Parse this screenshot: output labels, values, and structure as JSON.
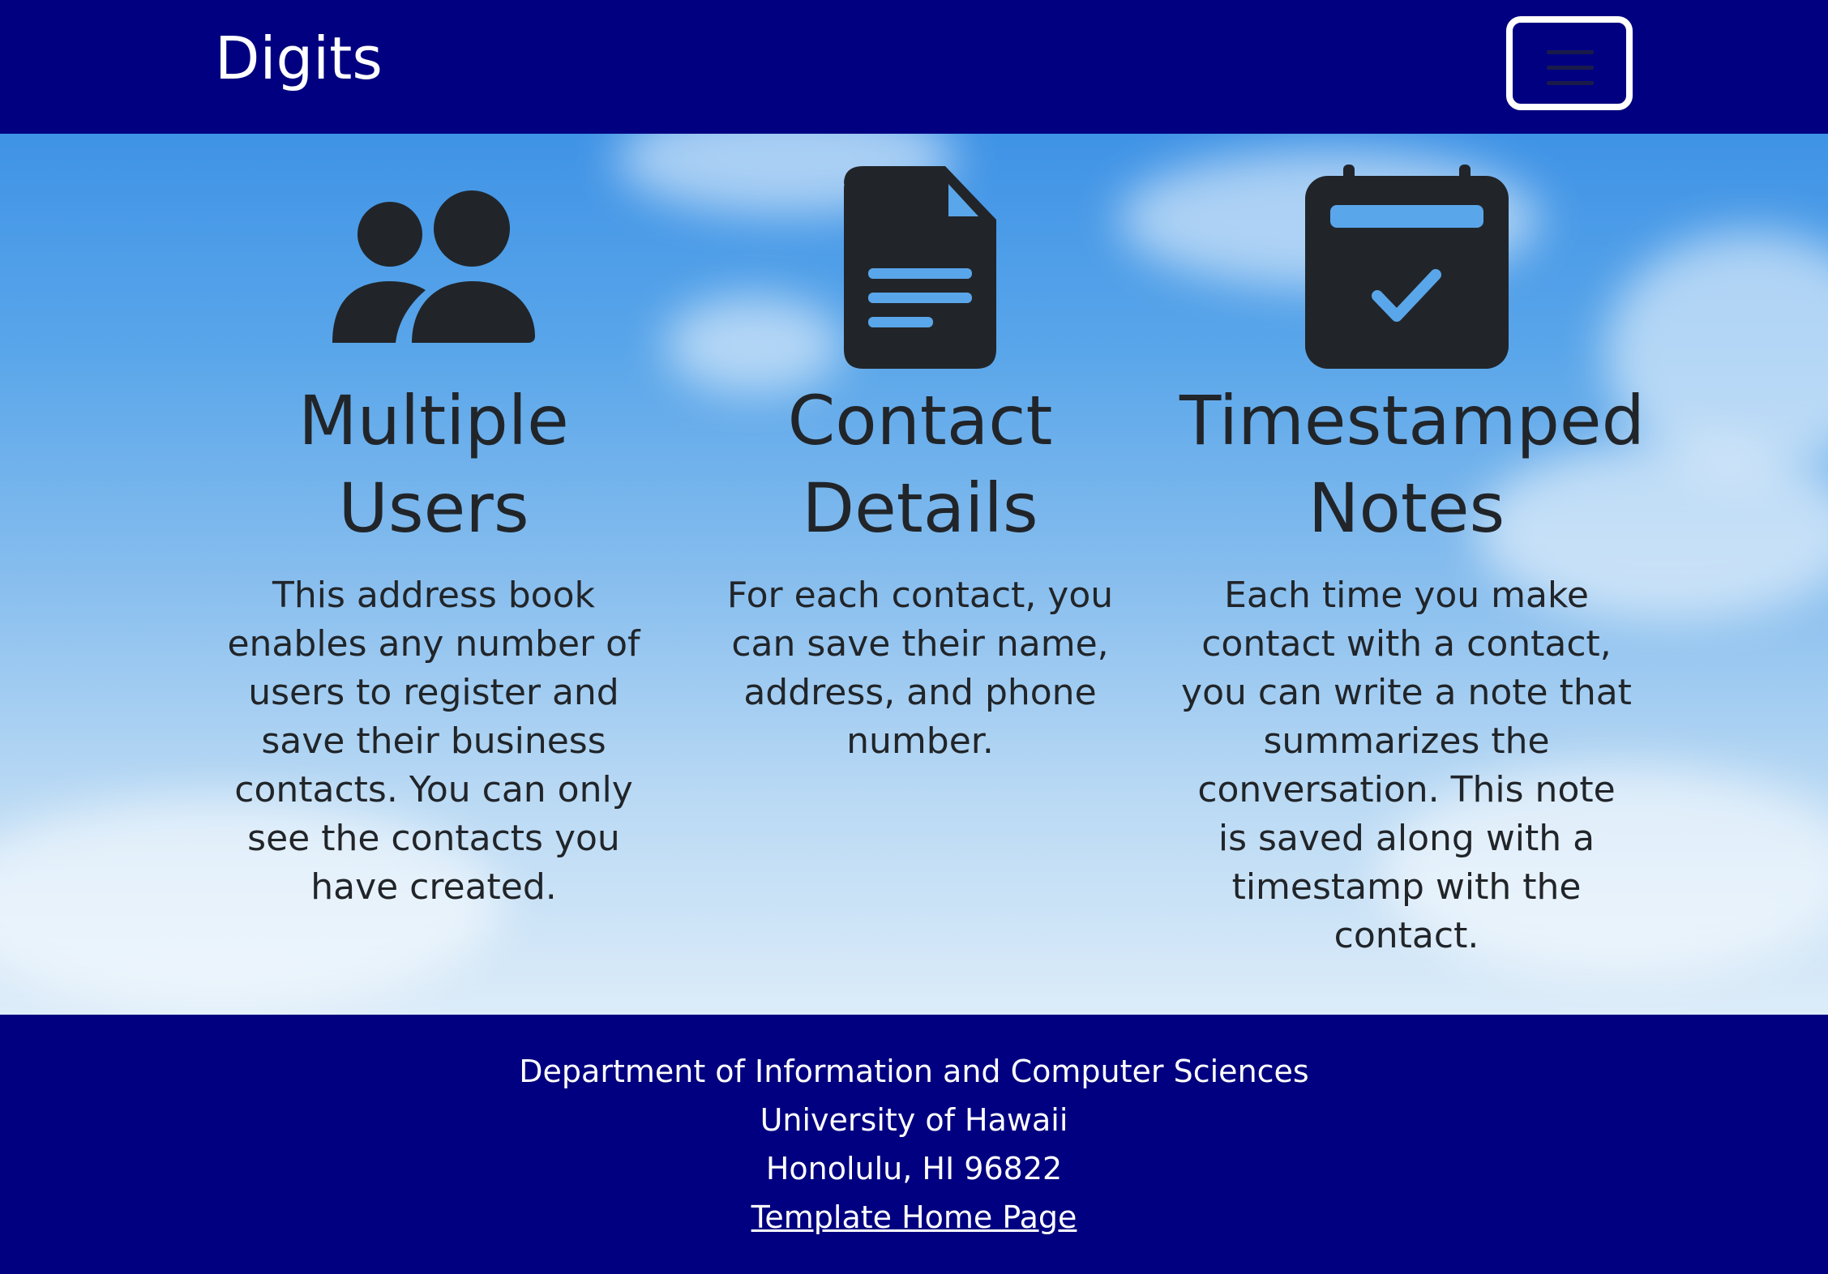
{
  "navbar": {
    "brand": "Digits",
    "toggler_icon": "hamburger-menu-icon"
  },
  "features": [
    {
      "icon": "people-icon",
      "title_line1": "Multiple",
      "title_line2": "Users",
      "description": "This address book enables any number of users to register and save their business contacts. You can only see the contacts you have created."
    },
    {
      "icon": "file-text-icon",
      "title_line1": "Contact",
      "title_line2": "Details",
      "description": "For each contact, you can save their name, address, and phone number."
    },
    {
      "icon": "calendar-check-icon",
      "title_line1": "Timestamped",
      "title_line2": "Notes",
      "description": "Each time you make contact with a contact, you can write a note that summarizes the conversation. This note is saved along with a timestamp with the contact."
    }
  ],
  "footer": {
    "department": "Department of Information and Computer Sciences",
    "university": "University of Hawaii",
    "address": "Honolulu, HI 96822",
    "link_label": "Template Home Page"
  },
  "colors": {
    "navbar_bg": "#000080",
    "footer_bg": "#000080",
    "text_dark": "#212529",
    "text_light": "#ffffff"
  }
}
